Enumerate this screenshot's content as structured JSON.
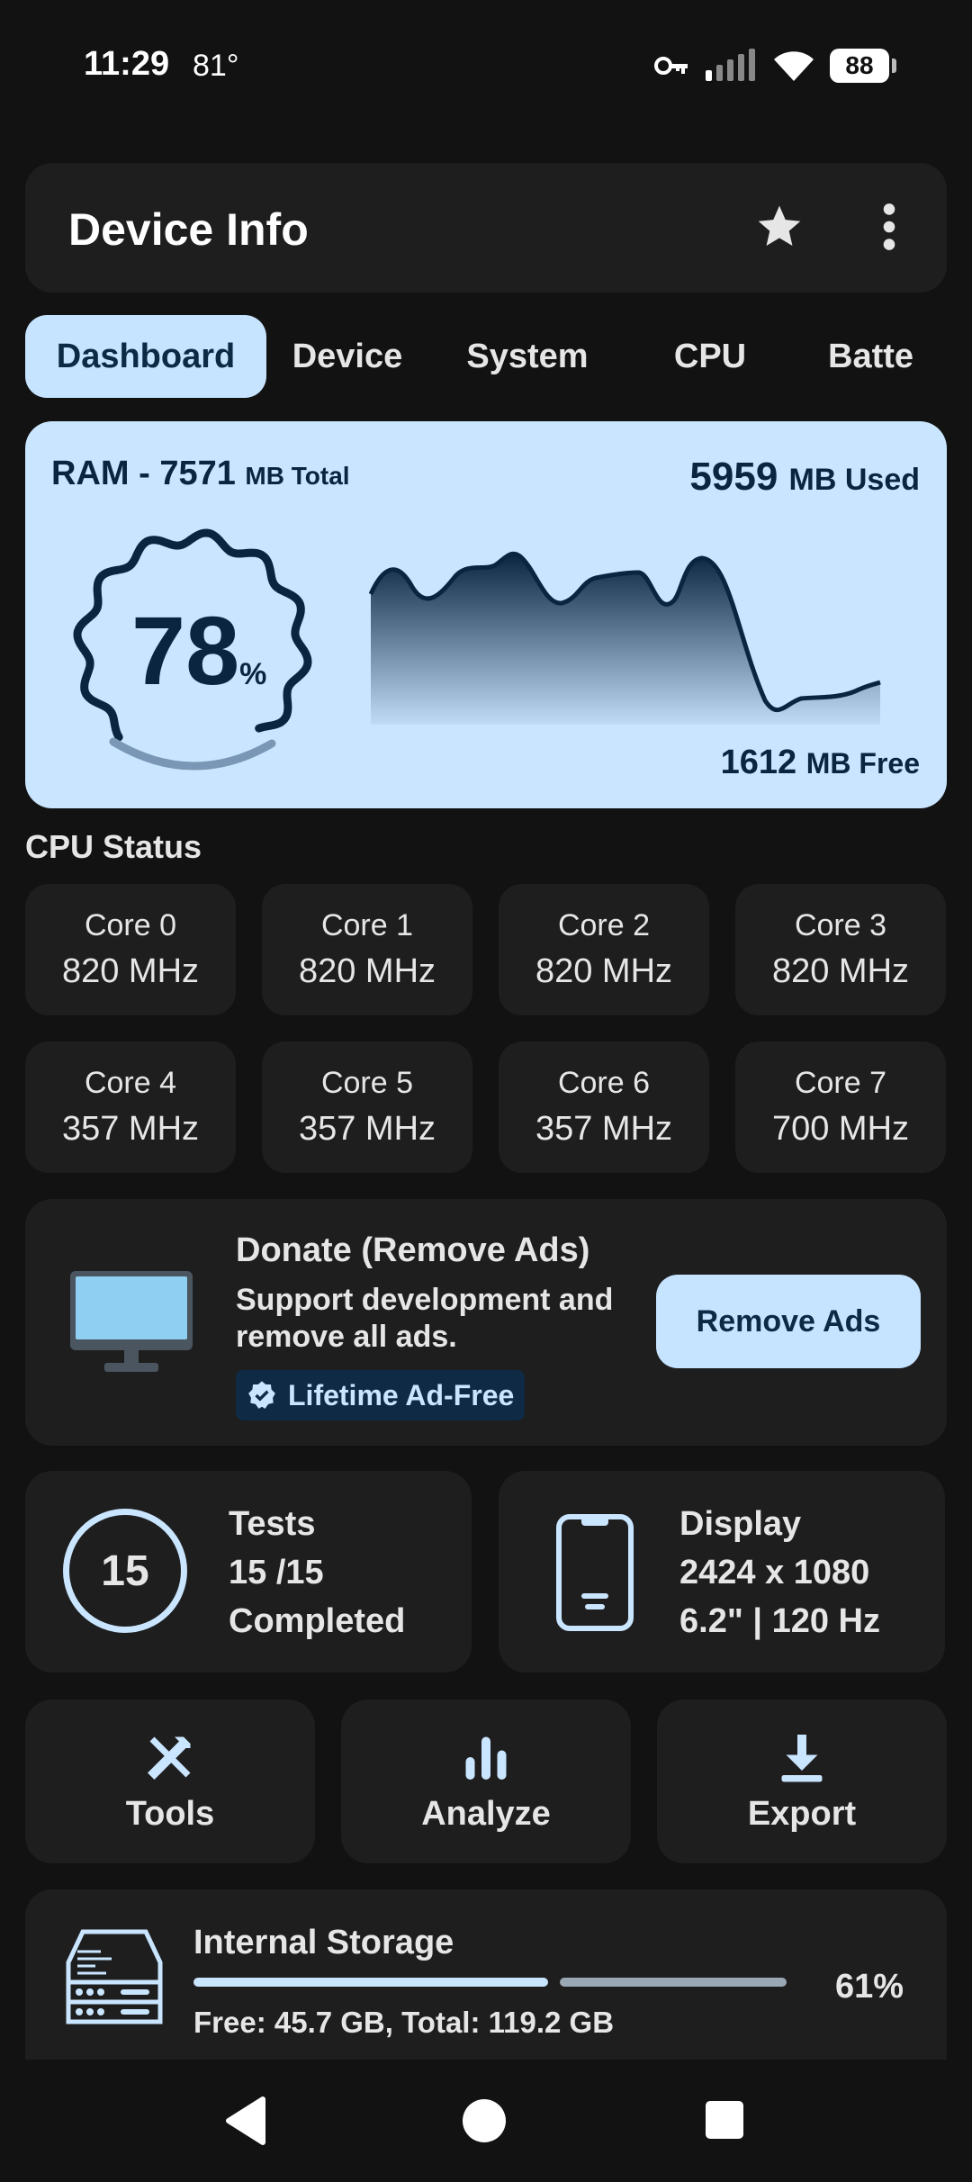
{
  "status_bar": {
    "time": "11:29",
    "temperature": "81°",
    "battery": "88"
  },
  "app_bar": {
    "title": "Device Info"
  },
  "tabs": [
    {
      "label": "Dashboard",
      "active": true
    },
    {
      "label": "Device"
    },
    {
      "label": "System"
    },
    {
      "label": "CPU"
    },
    {
      "label": "Batte"
    }
  ],
  "ram": {
    "title_prefix": "RAM - ",
    "total_value": "7571",
    "total_unit": "MB Total",
    "used_value": "5959",
    "used_unit": "MB Used",
    "free_value": "1612",
    "free_unit": "MB Free",
    "percent": "78",
    "percent_sign": "%",
    "usage_fraction": 0.78
  },
  "cpu": {
    "title": "CPU Status",
    "cores": [
      {
        "name": "Core 0",
        "freq": "820 MHz"
      },
      {
        "name": "Core 1",
        "freq": "820 MHz"
      },
      {
        "name": "Core 2",
        "freq": "820 MHz"
      },
      {
        "name": "Core 3",
        "freq": "820 MHz"
      },
      {
        "name": "Core 4",
        "freq": "357 MHz"
      },
      {
        "name": "Core 5",
        "freq": "357 MHz"
      },
      {
        "name": "Core 6",
        "freq": "357 MHz"
      },
      {
        "name": "Core 7",
        "freq": "700 MHz"
      }
    ]
  },
  "donate": {
    "title": "Donate (Remove Ads)",
    "description": "Support development and remove all ads.",
    "badge": "Lifetime Ad-Free",
    "button": "Remove Ads"
  },
  "tests": {
    "count": "15",
    "title": "Tests",
    "progress": "15 /15",
    "status": "Completed"
  },
  "display": {
    "title": "Display",
    "resolution": "2424 x 1080",
    "details": "6.2\" | 120 Hz"
  },
  "tools": [
    {
      "label": "Tools",
      "icon": "tools-icon"
    },
    {
      "label": "Analyze",
      "icon": "analyze-icon"
    },
    {
      "label": "Export",
      "icon": "export-icon"
    }
  ],
  "storage": {
    "title": "Internal Storage",
    "info": "Free: 45.7 GB,  Total: 119.2 GB",
    "percent": "61%",
    "used_fraction": 0.61
  },
  "colors": {
    "accent": "#C9E5FF",
    "card": "#1E1E1E",
    "background": "#121212",
    "dark_text": "#0A2540"
  }
}
